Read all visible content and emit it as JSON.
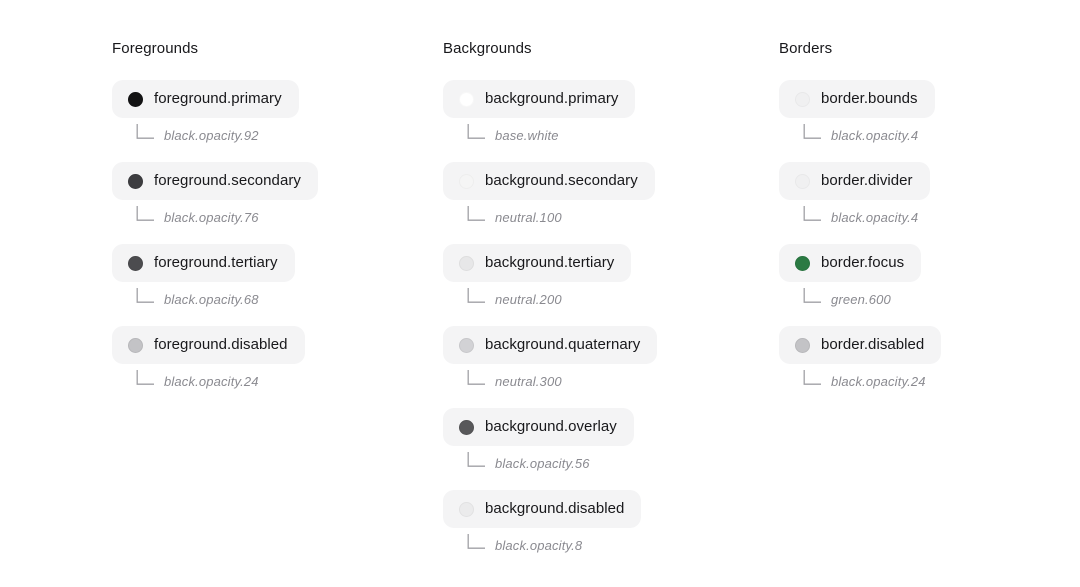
{
  "page": {
    "background_color": "#ffffff",
    "pill_background_color": "#f4f4f5",
    "title_color": "#18181b",
    "alias_color": "#8a8a90",
    "connector_color": "#a1a1a6"
  },
  "columns": [
    {
      "title": "Foregrounds",
      "tokens": [
        {
          "name": "foreground.primary",
          "alias": "black.opacity.92",
          "swatch_color": "#131314",
          "swatch_border": "rgba(0,0,0,0.06)"
        },
        {
          "name": "foreground.secondary",
          "alias": "black.opacity.76",
          "swatch_color": "#3d3d40",
          "swatch_border": "rgba(0,0,0,0.06)"
        },
        {
          "name": "foreground.tertiary",
          "alias": "black.opacity.68",
          "swatch_color": "#4c4c4f",
          "swatch_border": "rgba(0,0,0,0.06)"
        },
        {
          "name": "foreground.disabled",
          "alias": "black.opacity.24",
          "swatch_color": "#c3c3c6",
          "swatch_border": "rgba(0,0,0,0.06)"
        }
      ]
    },
    {
      "title": "Backgrounds",
      "tokens": [
        {
          "name": "background.primary",
          "alias": "base.white",
          "swatch_color": "#ffffff",
          "swatch_border": "rgba(0,0,0,0.03)"
        },
        {
          "name": "background.secondary",
          "alias": "neutral.100",
          "swatch_color": "#f5f5f5",
          "swatch_border": "rgba(0,0,0,0.03)"
        },
        {
          "name": "background.tertiary",
          "alias": "neutral.200",
          "swatch_color": "#e7e7e8",
          "swatch_border": "rgba(0,0,0,0.04)"
        },
        {
          "name": "background.quaternary",
          "alias": "neutral.300",
          "swatch_color": "#d2d2d5",
          "swatch_border": "rgba(0,0,0,0.05)"
        },
        {
          "name": "background.overlay",
          "alias": "black.opacity.56",
          "swatch_color": "#58585a",
          "swatch_border": "rgba(0,0,0,0.06)"
        },
        {
          "name": "background.disabled",
          "alias": "black.opacity.8",
          "swatch_color": "#ebebec",
          "swatch_border": "rgba(0,0,0,0.04)"
        }
      ]
    },
    {
      "title": "Borders",
      "tokens": [
        {
          "name": "border.bounds",
          "alias": "black.opacity.4",
          "swatch_color": "#f0f0f1",
          "swatch_border": "rgba(0,0,0,0.03)"
        },
        {
          "name": "border.divider",
          "alias": "black.opacity.4",
          "swatch_color": "#f0f0f1",
          "swatch_border": "rgba(0,0,0,0.03)"
        },
        {
          "name": "border.focus",
          "alias": "green.600",
          "swatch_color": "#2b7a43",
          "swatch_border": "rgba(0,0,0,0.06)"
        },
        {
          "name": "border.disabled",
          "alias": "black.opacity.24",
          "swatch_color": "#c3c3c6",
          "swatch_border": "rgba(0,0,0,0.06)"
        }
      ]
    }
  ]
}
